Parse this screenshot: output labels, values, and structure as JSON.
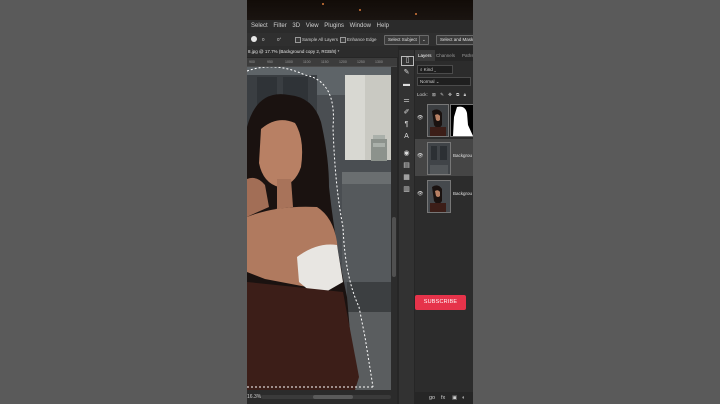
{
  "menubar": {
    "items": [
      "Select",
      "Filter",
      "3D",
      "View",
      "Plugins",
      "Window",
      "Help"
    ]
  },
  "options_bar": {
    "brush_size": "0",
    "brush_angle": "0°",
    "sample_all_layers_label": "Sample All Layers",
    "enhance_edge_label": "Enhance Edge",
    "select_subject_label": "Select Subject",
    "select_mask_label": "Select and Mask..."
  },
  "document": {
    "tab_title": "8.jpg @ 17.7% (Background copy 2, RGB/8) *",
    "ruler_ticks": [
      "900",
      "950",
      "1000",
      "1100",
      "1150",
      "1200",
      "1250",
      "1300"
    ],
    "zoom": "16.3%"
  },
  "layers_panel": {
    "tabs": [
      "Layers",
      "Channels",
      "Paths"
    ],
    "kind_label": "Kind",
    "blend_mode": "Normal",
    "lock_label": "Lock:",
    "layers": [
      {
        "name": "",
        "visible": true
      },
      {
        "name": "Backgrou",
        "visible": true
      },
      {
        "name": "Backgrou",
        "visible": true
      }
    ],
    "bottom_icons": [
      "go",
      "fx",
      "mask",
      "adjust"
    ]
  },
  "overlay": {
    "subscribe_label": "SUBSCRIBE"
  },
  "colors": {
    "subscribe": "#e6334a",
    "panel": "#2c2c2c",
    "side": "#5a5a5a"
  }
}
